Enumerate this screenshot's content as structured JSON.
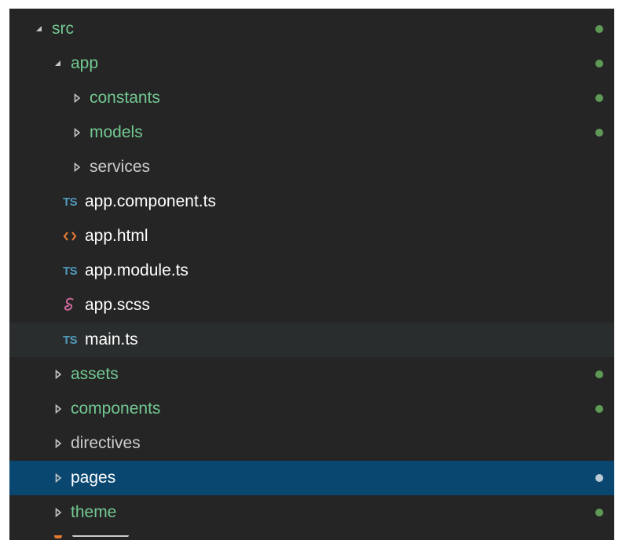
{
  "tree": {
    "src": {
      "label": "src"
    },
    "app": {
      "label": "app"
    },
    "constants": {
      "label": "constants"
    },
    "models": {
      "label": "models"
    },
    "services": {
      "label": "services"
    },
    "app_component": {
      "icon": "TS",
      "label": "app.component.ts"
    },
    "app_html": {
      "icon": "html-file-icon",
      "label": "app.html"
    },
    "app_module": {
      "icon": "TS",
      "label": "app.module.ts"
    },
    "app_scss": {
      "icon": "sass-file-icon",
      "label": "app.scss"
    },
    "main_ts": {
      "icon": "TS",
      "label": "main.ts"
    },
    "assets": {
      "label": "assets"
    },
    "components": {
      "label": "components"
    },
    "directives": {
      "label": "directives"
    },
    "pages": {
      "label": "pages"
    },
    "theme": {
      "label": "theme"
    }
  },
  "icons": {
    "expanded": "triangle-down-icon",
    "collapsed": "triangle-right-icon",
    "modified_dot": "git-modified-dot-icon"
  },
  "colors": {
    "sidebar_bg": "#252526",
    "selection": "#094771",
    "hover": "#2a2d2e",
    "git_added_text": "#73c991",
    "git_dot": "#5e9a55",
    "ts_icon": "#519aba",
    "html_icon": "#e37933",
    "sass_icon": "#cd6799"
  }
}
